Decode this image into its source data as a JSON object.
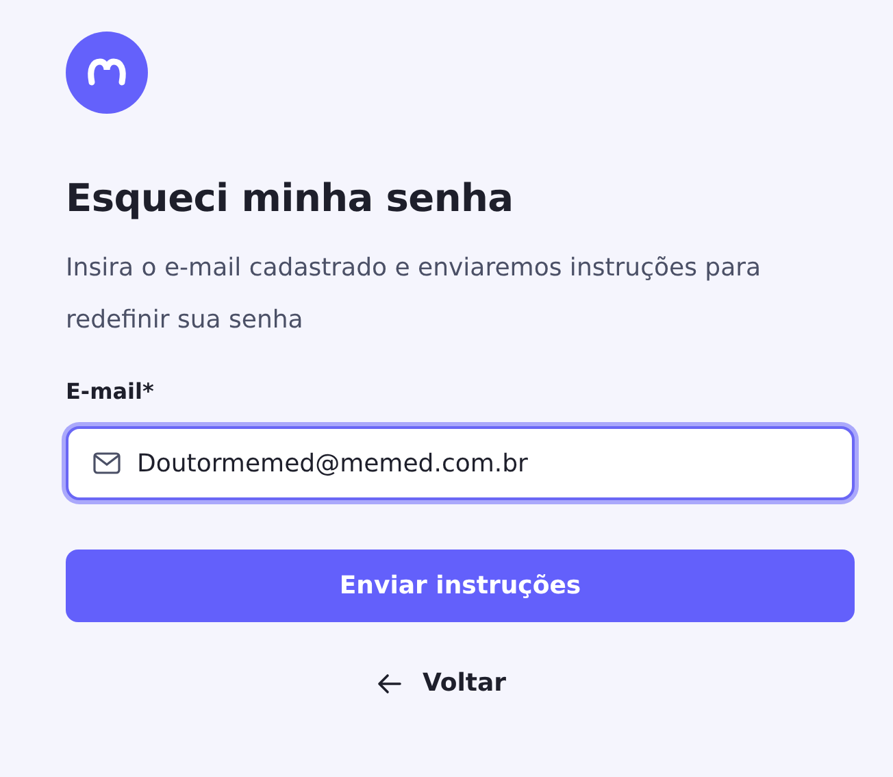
{
  "title": "Esqueci minha senha",
  "subtitle": "Insira o e-mail cadastrado e enviaremos instruções para redefinir sua senha",
  "email_field": {
    "label": "E-mail*",
    "value": "Doutormemed@memed.com.br",
    "focused": true
  },
  "submit_button": {
    "label": "Enviar instruções"
  },
  "back_link": {
    "label": "Voltar"
  }
}
